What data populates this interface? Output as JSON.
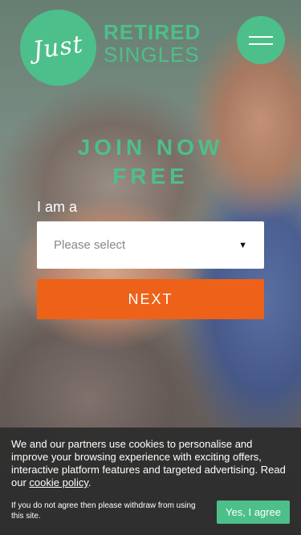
{
  "brand": {
    "script_logo": "Just",
    "line1": "RETIRED",
    "line2": "SINGLES",
    "color": "#4dbf8a"
  },
  "menu": {
    "icon": "hamburger-icon"
  },
  "signup": {
    "headline_line1": "JOIN NOW",
    "headline_line2": "FREE",
    "label": "I am a",
    "select_placeholder": "Please select",
    "next_label": "NEXT",
    "next_color": "#ee6118"
  },
  "cookie": {
    "text": "We and our partners use cookies to personalise and improve your browsing experience with exciting offers, interactive platform features and targeted advertising. Read our ",
    "link_text": "cookie policy",
    "text_end": ".",
    "small_text": "If you do not agree then please withdraw from using this site.",
    "accept_label": "Yes, I agree"
  }
}
